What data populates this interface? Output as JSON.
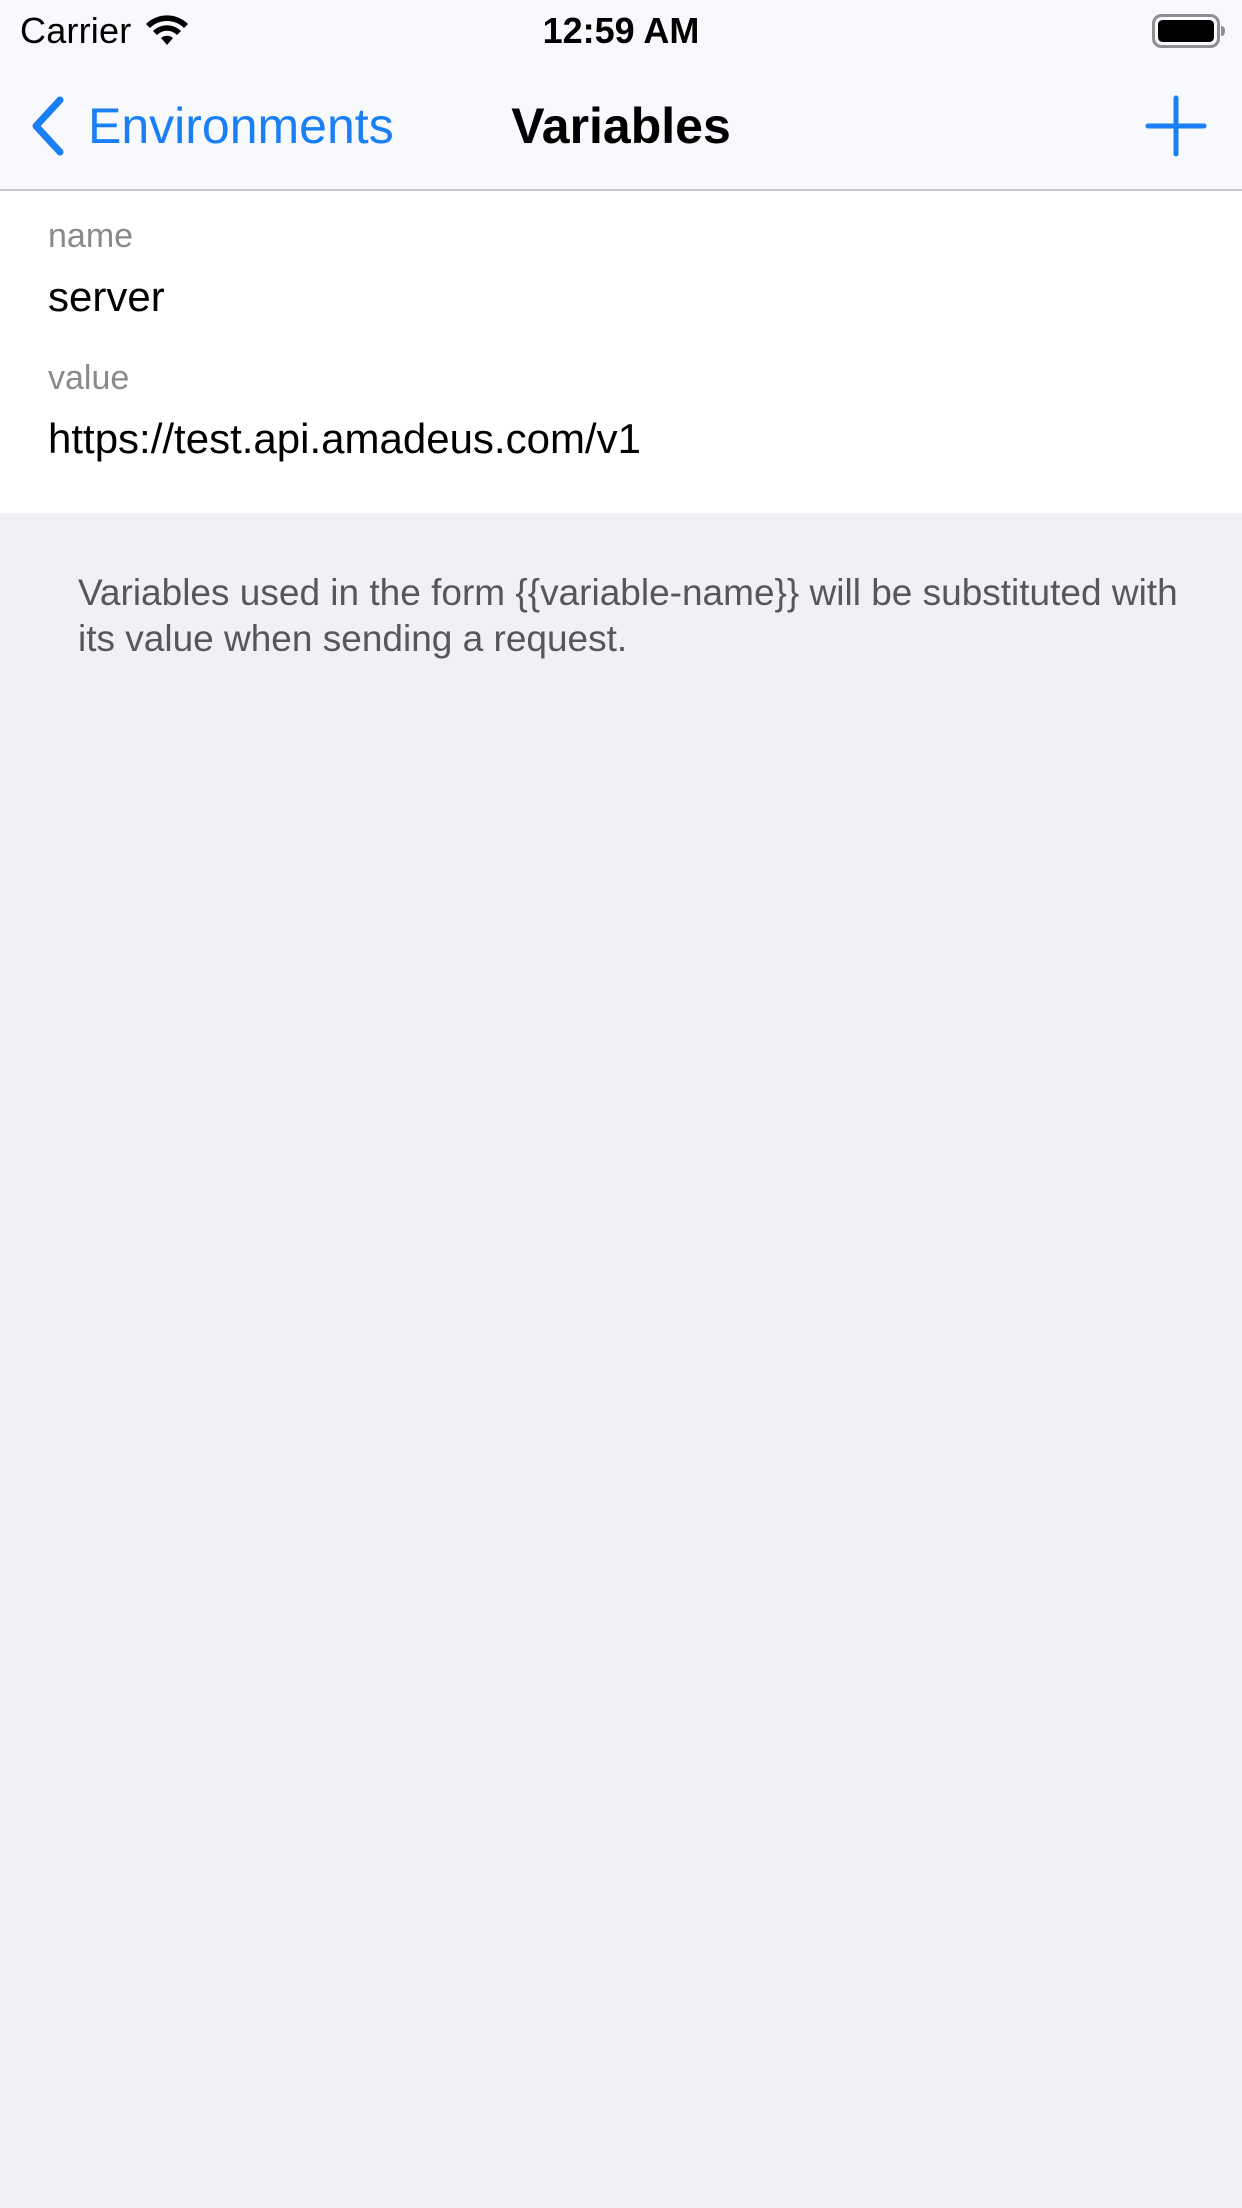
{
  "status_bar": {
    "carrier": "Carrier",
    "time": "12:59 AM",
    "icons": [
      "wifi-icon",
      "battery-icon"
    ]
  },
  "nav": {
    "back_label": "Environments",
    "title": "Variables",
    "back_icon": "chevron-left-icon",
    "add_icon": "plus-icon"
  },
  "variable": {
    "name_label": "name",
    "name_value": "server",
    "value_label": "value",
    "value_value": "https://test.api.amadeus.com/v1"
  },
  "footer": {
    "note": "Variables used in the form {{variable-name}} will be substituted with its value when sending a request."
  },
  "colors": {
    "accent": "#1a7ef5",
    "background": "#f0f0f5",
    "card": "#ffffff",
    "secondary_text": "#8a8a8e"
  }
}
